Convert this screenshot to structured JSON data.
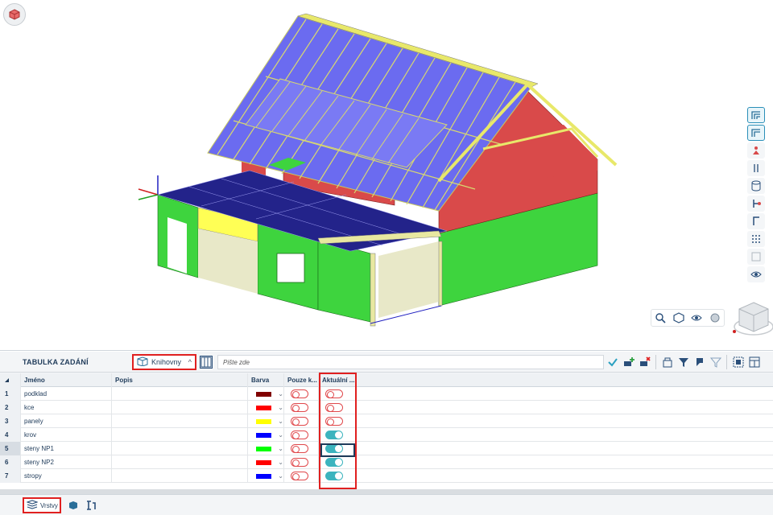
{
  "panel": {
    "title": "TABULKA ZADÁNÍ",
    "libraries_label": "Knihovny",
    "search_placeholder": "Pište zde"
  },
  "table": {
    "columns": {
      "name": "Jméno",
      "description": "Popis",
      "color": "Barva",
      "only_k": "Pouze k...",
      "active": "Aktuální ..."
    },
    "rows": [
      {
        "num": "1",
        "name": "podklad",
        "description": "",
        "color": "#800000",
        "only": false,
        "active": false
      },
      {
        "num": "2",
        "name": "kce",
        "description": "",
        "color": "#ff0000",
        "only": false,
        "active": false
      },
      {
        "num": "3",
        "name": "panely",
        "description": "",
        "color": "#ffff00",
        "only": false,
        "active": false
      },
      {
        "num": "4",
        "name": "krov",
        "description": "",
        "color": "#0000ff",
        "only": false,
        "active": true
      },
      {
        "num": "5",
        "name": "steny NP1",
        "description": "",
        "color": "#00ff00",
        "only": false,
        "active": true
      },
      {
        "num": "6",
        "name": "steny NP2",
        "description": "",
        "color": "#ff0000",
        "only": false,
        "active": true
      },
      {
        "num": "7",
        "name": "stropy",
        "description": "",
        "color": "#0000ff",
        "only": false,
        "active": true
      }
    ]
  },
  "bottom_tabs": {
    "layers_label": "Vrstvy"
  },
  "colors": {
    "roof": "#6b6bf0",
    "wall_red": "#d94a4a",
    "wall_green": "#3ed43e",
    "slab": "#23238a",
    "beam": "#e8e86a",
    "accent": "#3cb4be",
    "highlight": "#e02020"
  },
  "icons": [
    "home-view-icon",
    "libraries-icon",
    "table-icon",
    "check-icon",
    "add-row-icon",
    "delete-row-icon",
    "filter-icon",
    "layers-icon",
    "zoom-icon"
  ]
}
